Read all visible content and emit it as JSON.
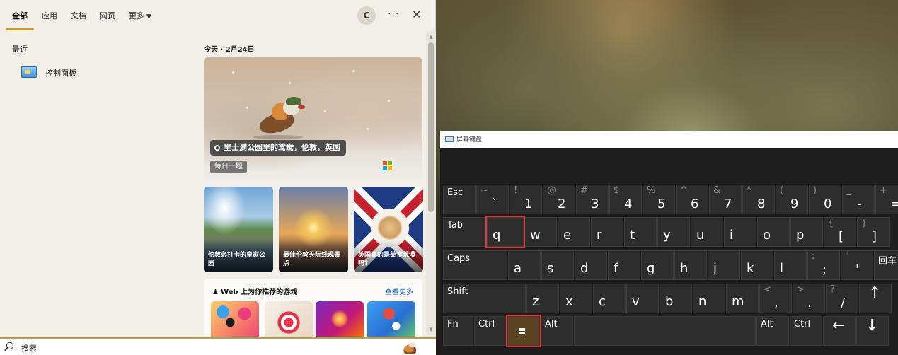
{
  "search": {
    "tabs": [
      {
        "label": "全部",
        "active": true
      },
      {
        "label": "应用"
      },
      {
        "label": "文档"
      },
      {
        "label": "网页"
      },
      {
        "label": "更多"
      }
    ],
    "avatar_letter": "C",
    "more_glyph": "···",
    "close_glyph": "✕",
    "recent": {
      "title": "最近",
      "items": [
        {
          "label": "控制面板",
          "icon": "control-panel-icon"
        }
      ]
    },
    "today": {
      "header": "今天 · 2月24日",
      "hero": {
        "caption": "里士满公园里的鸳鸯，伦敦，英国",
        "chip": "每日一题"
      },
      "news": [
        {
          "title": "伦敦必打卡的皇家公园"
        },
        {
          "title": "最佳伦敦天际线观景点"
        },
        {
          "title": "英国真的是美食荒漠吗?"
        }
      ],
      "games": {
        "title": "Web 上为你推荐的游戏",
        "more": "查看更多"
      }
    },
    "box": {
      "text": "搜索"
    }
  },
  "osk": {
    "title": "屏幕键盘",
    "rows": [
      [
        {
          "main": "Esc",
          "type": "mod"
        },
        {
          "shift": "~",
          "main": "`"
        },
        {
          "shift": "!",
          "main": "1"
        },
        {
          "shift": "@",
          "main": "2"
        },
        {
          "shift": "#",
          "main": "3"
        },
        {
          "shift": "$",
          "main": "4"
        },
        {
          "shift": "%",
          "main": "5"
        },
        {
          "shift": "^",
          "main": "6"
        },
        {
          "shift": "&",
          "main": "7"
        },
        {
          "shift": "*",
          "main": "8"
        },
        {
          "shift": "(",
          "main": "9"
        },
        {
          "shift": ")",
          "main": "0"
        },
        {
          "shift": "_",
          "main": "-"
        },
        {
          "shift": "+",
          "main": "="
        }
      ],
      [
        {
          "main": "Tab",
          "type": "mod"
        },
        {
          "main": "q",
          "highlight": true
        },
        {
          "main": "w"
        },
        {
          "main": "e"
        },
        {
          "main": "r"
        },
        {
          "main": "t"
        },
        {
          "main": "y"
        },
        {
          "main": "u"
        },
        {
          "main": "i"
        },
        {
          "main": "o"
        },
        {
          "main": "p"
        },
        {
          "shift": "{",
          "main": "["
        },
        {
          "shift": "}",
          "main": "]"
        }
      ],
      [
        {
          "main": "Caps",
          "type": "mod"
        },
        {
          "main": "a"
        },
        {
          "main": "s"
        },
        {
          "main": "d"
        },
        {
          "main": "f"
        },
        {
          "main": "g"
        },
        {
          "main": "h"
        },
        {
          "main": "j"
        },
        {
          "main": "k"
        },
        {
          "main": "l"
        },
        {
          "shift": ":",
          "main": ";"
        },
        {
          "shift": "\"",
          "main": "'"
        },
        {
          "main": "回车",
          "type": "mod"
        }
      ],
      [
        {
          "main": "Shift",
          "type": "mod"
        },
        {
          "main": "z"
        },
        {
          "main": "x"
        },
        {
          "main": "c"
        },
        {
          "main": "v"
        },
        {
          "main": "b"
        },
        {
          "main": "n"
        },
        {
          "main": "m"
        },
        {
          "shift": "<",
          "main": ","
        },
        {
          "shift": ">",
          "main": "."
        },
        {
          "shift": "?",
          "main": "/"
        },
        {
          "main": "↑",
          "type": "arrow"
        }
      ],
      [
        {
          "main": "Fn",
          "type": "mod"
        },
        {
          "main": "Ctrl",
          "type": "mod"
        },
        {
          "main": "win",
          "type": "win",
          "highlight": true
        },
        {
          "main": "Alt",
          "type": "mod"
        },
        {
          "main": "",
          "type": "space"
        },
        {
          "main": "Alt",
          "type": "mod"
        },
        {
          "main": "Ctrl",
          "type": "mod"
        },
        {
          "main": "←",
          "type": "arrow"
        },
        {
          "main": "↓",
          "type": "arrow"
        }
      ]
    ]
  }
}
